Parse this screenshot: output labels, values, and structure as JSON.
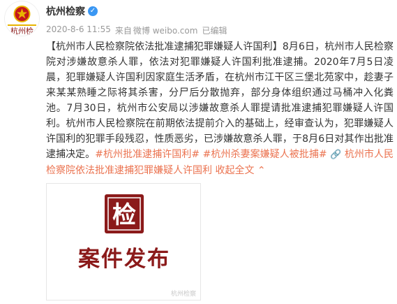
{
  "user": {
    "name": "杭州检察",
    "verified_icon": "verified-badge-icon",
    "avatar_icon": "procuratorate-emblem-icon",
    "avatar_text": "杭州检"
  },
  "meta": {
    "date": "2020-8-6 11:55",
    "source_prefix": "来自",
    "source": "微博 weibo.com",
    "edited": "已编辑"
  },
  "post": {
    "title": "【杭州市人民检察院依法批准逮捕犯罪嫌疑人许国利】",
    "body": "8月6日，杭州市人民检察院对涉嫌故意杀人罪，依法对犯罪嫌疑人许国利批准逮捕。2020年7月5日凌晨，犯罪嫌疑人许国利因家庭生活矛盾，在杭州市江干区三堡北苑家中，趁妻子来某某熟睡之际将其杀害，分尸后分散抛弃，部分身体组织通过马桶冲入化粪池。7月30日，杭州市公安局以涉嫌故意杀人罪提请批准逮捕犯罪嫌疑人许国利。杭州市人民检察院在前期依法提前介入的基础上，经审查认为，犯罪嫌疑人许国利的犯罪手段残忍，性质恶劣，已涉嫌故意杀人罪，于8月6日对其作出批准逮捕决定。",
    "topic1": "#杭州批准逮捕许国利#",
    "topic2": "#杭州杀妻案嫌疑人被批捕#",
    "link_icon": "link-icon",
    "link_text": "杭州市人民检察院依法批准逮捕犯罪嫌疑人许国利",
    "collapse": "收起全文",
    "collapse_icon": "chevron-up-icon"
  },
  "media": {
    "logo_icon": "case-release-logo-icon",
    "logo_char": "检",
    "title": "案件发布",
    "watermark": "杭州检察"
  },
  "colors": {
    "link": "#eb7350",
    "logo_red": "#8b1a1a",
    "emblem_red": "#c4161c",
    "emblem_gold": "#e8b400"
  }
}
